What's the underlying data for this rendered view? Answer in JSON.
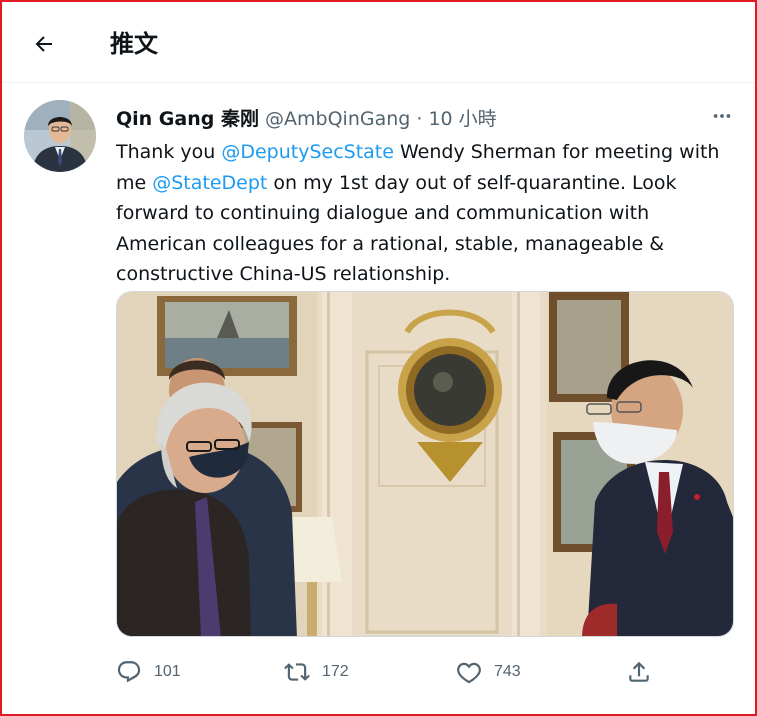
{
  "header": {
    "title": "推文"
  },
  "tweet": {
    "author_name": "Qin Gang 秦刚",
    "handle": "@AmbQinGang",
    "separator": "·",
    "time": "10 小時",
    "text": {
      "t1": "Thank you ",
      "m1": "@DeputySecState",
      "t2": " Wendy Sherman for meeting with me ",
      "m2": "@StateDept",
      "t3": " on my 1st day out of self-quarantine. Look forward to continuing dialogue and communication with American colleagues for a rational, stable, manageable & constructive China-US relationship."
    },
    "stats": {
      "replies": "101",
      "retweets": "172",
      "likes": "743"
    }
  },
  "icons": {
    "back": "arrow-left-icon",
    "more": "more-horizontal-icon",
    "reply": "reply-icon",
    "retweet": "retweet-icon",
    "like": "heart-icon",
    "share": "share-icon"
  },
  "colors": {
    "accent": "#1d9bf0",
    "secondary_text": "#536471",
    "frame_border": "#e01b24"
  }
}
